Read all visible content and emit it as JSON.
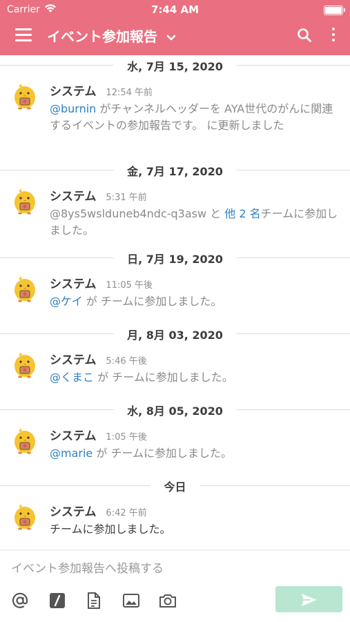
{
  "status_bar": {
    "carrier": "Carrier",
    "time": "7:44 AM"
  },
  "header": {
    "channel_name": "イベント参加報告",
    "accent_color": "#ea6f80"
  },
  "posts": [
    {
      "date": "水, 7月 15, 2020",
      "user": "システム",
      "time": "12:54 午前",
      "mention": "@burnin",
      "message": "がチャンネルヘッダーを AYA世代のがんに関連するイベントの参加報告です。 に更新しました"
    },
    {
      "date": "金, 7月 17, 2020",
      "user": "システム",
      "time": "5:31 午前",
      "prefix": "@8ys5wslduneb4ndc-q3asw と ",
      "mention": "他 2 名",
      "message": "チームに参加しました。"
    },
    {
      "date": "日, 7月 19, 2020",
      "user": "システム",
      "time": "11:05 午後",
      "mention": "@ケイ",
      "message": " が チームに参加しました。"
    },
    {
      "date": "月, 8月 03, 2020",
      "user": "システム",
      "time": "5:46 午後",
      "mention": "@くまこ",
      "message": " が チームに参加しました。"
    },
    {
      "date": "水, 8月 05, 2020",
      "user": "システム",
      "time": "1:05 午後",
      "mention": "@marie",
      "message": " が チームに参加しました。"
    },
    {
      "date": "今日",
      "user": "システム",
      "time": "6:42 午前",
      "message": "チームに参加しました。"
    }
  ],
  "composer": {
    "placeholder": "イベント参加報告へ投稿する",
    "icons": [
      "at-icon",
      "slash-command-icon",
      "file-icon",
      "image-icon",
      "camera-icon",
      "send-icon"
    ]
  }
}
